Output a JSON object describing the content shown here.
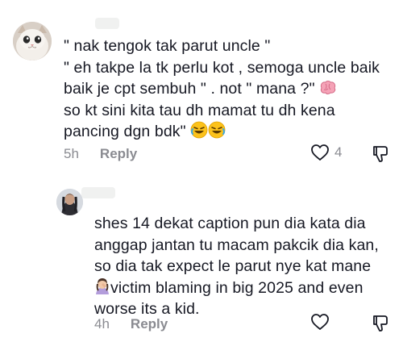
{
  "comments": [
    {
      "avatar": "cat-avatar",
      "lines": [
        "\" nak tengok tak parut uncle \"",
        "\" eh takpe la tk perlu kot , semoga uncle baik",
        "baik je cpt sembuh \" . not \" mana ?\"",
        "so kt sini kita tau dh mamat tu dh kena",
        "pancing dgn bdk\""
      ],
      "line3_emoji": "brain-emoji",
      "line5_emoji": "rolling-on-floor-laughing-emoji",
      "time": "5h",
      "reply_label": "Reply",
      "like_count": "4"
    },
    {
      "avatar": "user-avatar",
      "lines": [
        "shes 14 dekat caption pun dia kata dia",
        "anggap jantan tu macam pakcik dia kan,",
        "so dia tak expect le parut nye kat mane",
        "victim blaming in big 2025 and even",
        "worse its a kid."
      ],
      "line4_emoji": "woman-facepalming-emoji",
      "time": "4h",
      "reply_label": "Reply",
      "like_count": ""
    }
  ],
  "colors": {
    "text": "#161823",
    "muted": "#8a8b91"
  }
}
